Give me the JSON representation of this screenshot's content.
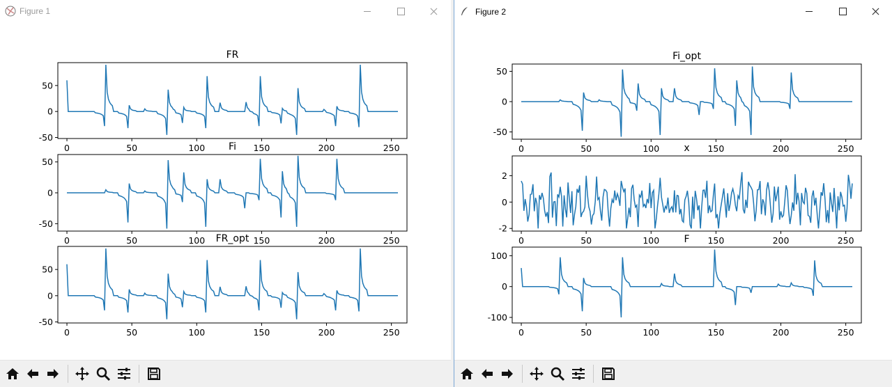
{
  "window1": {
    "title": "Figure 1"
  },
  "window2": {
    "title": "Figure 2"
  },
  "toolbar": {
    "buttons": [
      "home-icon",
      "back-arrow-icon",
      "forward-arrow-icon",
      "pan-icon",
      "zoom-icon",
      "configure-subplots-icon",
      "save-icon"
    ]
  },
  "colors": {
    "line": "#1f77b4",
    "window_accent": "#7aa7d6"
  },
  "chart_data": [
    {
      "figure": "Figure 1",
      "type": "line",
      "title": "FR",
      "xlim": [
        -7,
        262
      ],
      "ylim": [
        -52,
        94
      ],
      "xticks": [
        0,
        50,
        100,
        150,
        200,
        250
      ],
      "yticks": [
        -50,
        0,
        50
      ],
      "series": [
        {
          "spikes": [
            [
              30,
              90,
              -28
            ],
            [
              48,
              12,
              -32
            ],
            [
              60,
              5,
              0
            ],
            [
              78,
              42,
              -45
            ],
            [
              90,
              8,
              -22
            ],
            [
              108,
              68,
              -32
            ],
            [
              118,
              17,
              0
            ],
            [
              138,
              18,
              0
            ],
            [
              149,
              68,
              -28
            ],
            [
              166,
              6,
              -23
            ],
            [
              178,
              45,
              -45
            ],
            [
              198,
              4,
              0
            ],
            [
              208,
              10,
              -28
            ],
            [
              226,
              90,
              -30
            ]
          ],
          "start": 60,
          "n": 256
        }
      ]
    },
    {
      "figure": "Figure 1",
      "type": "line",
      "title": "Fi",
      "xlim": [
        -7,
        262
      ],
      "ylim": [
        -62,
        62
      ],
      "xticks": [
        0,
        50,
        100,
        150,
        200,
        250
      ],
      "yticks": [
        -50,
        0,
        50
      ],
      "series": [
        {
          "spikes": [
            [
              30,
              5,
              0
            ],
            [
              48,
              15,
              -48
            ],
            [
              60,
              3,
              0
            ],
            [
              78,
              53,
              -58
            ],
            [
              90,
              33,
              -15
            ],
            [
              108,
              22,
              -55
            ],
            [
              118,
              22,
              0
            ],
            [
              138,
              0,
              -25
            ],
            [
              149,
              55,
              -12
            ],
            [
              166,
              35,
              -40
            ],
            [
              178,
              60,
              -55
            ],
            [
              198,
              0,
              0
            ],
            [
              208,
              55,
              -12
            ],
            [
              226,
              0,
              0
            ]
          ],
          "start": 0,
          "n": 256
        }
      ]
    },
    {
      "figure": "Figure 1",
      "type": "line",
      "title": "FR_opt",
      "xlim": [
        -7,
        262
      ],
      "ylim": [
        -52,
        94
      ],
      "xticks": [
        0,
        50,
        100,
        150,
        200,
        250
      ],
      "yticks": [
        -50,
        0,
        50
      ],
      "series": [
        {
          "spikes": [
            [
              30,
              90,
              -28
            ],
            [
              48,
              12,
              -32
            ],
            [
              60,
              5,
              0
            ],
            [
              78,
              42,
              -45
            ],
            [
              90,
              8,
              -22
            ],
            [
              108,
              68,
              -32
            ],
            [
              118,
              17,
              0
            ],
            [
              138,
              18,
              0
            ],
            [
              149,
              68,
              -28
            ],
            [
              166,
              6,
              -23
            ],
            [
              178,
              45,
              -45
            ],
            [
              198,
              4,
              0
            ],
            [
              208,
              10,
              -28
            ],
            [
              226,
              90,
              -30
            ]
          ],
          "start": 60,
          "n": 256
        }
      ]
    },
    {
      "figure": "Figure 2",
      "type": "line",
      "title": "Fi_opt",
      "xlim": [
        -7,
        262
      ],
      "ylim": [
        -62,
        62
      ],
      "xticks": [
        0,
        50,
        100,
        150,
        200,
        250
      ],
      "yticks": [
        -50,
        0,
        50
      ],
      "series": [
        {
          "spikes": [
            [
              30,
              3,
              0
            ],
            [
              48,
              15,
              -48
            ],
            [
              60,
              3,
              0
            ],
            [
              78,
              53,
              -58
            ],
            [
              90,
              30,
              -15
            ],
            [
              108,
              22,
              -55
            ],
            [
              118,
              22,
              0
            ],
            [
              138,
              0,
              -22
            ],
            [
              149,
              55,
              -12
            ],
            [
              166,
              35,
              -40
            ],
            [
              178,
              58,
              -55
            ],
            [
              198,
              0,
              0
            ],
            [
              208,
              48,
              -12
            ],
            [
              226,
              0,
              0
            ]
          ],
          "start": 0,
          "n": 256
        }
      ]
    },
    {
      "figure": "Figure 2",
      "type": "line",
      "title": "x",
      "xlim": [
        -7,
        262
      ],
      "ylim": [
        -2.2,
        3.5
      ],
      "xticks": [
        0,
        50,
        100,
        150,
        200,
        250
      ],
      "yticks": [
        -2,
        0,
        2
      ],
      "series": [
        {
          "noise": true,
          "amplitude": 3.1,
          "n": 256
        }
      ]
    },
    {
      "figure": "Figure 2",
      "type": "line",
      "title": "F",
      "xlim": [
        -7,
        262
      ],
      "ylim": [
        -118,
        128
      ],
      "xticks": [
        0,
        50,
        100,
        150,
        200,
        250
      ],
      "yticks": [
        -100,
        0,
        100
      ],
      "series": [
        {
          "spikes": [
            [
              30,
              95,
              -25
            ],
            [
              48,
              28,
              -80
            ],
            [
              78,
              95,
              -100
            ],
            [
              108,
              10,
              0
            ],
            [
              118,
              42,
              0
            ],
            [
              149,
              120,
              0
            ],
            [
              166,
              0,
              -60
            ],
            [
              178,
              0,
              -20
            ],
            [
              198,
              8,
              0
            ],
            [
              208,
              12,
              0
            ],
            [
              226,
              85,
              -30
            ]
          ],
          "start": 60,
          "n": 256
        }
      ]
    }
  ]
}
